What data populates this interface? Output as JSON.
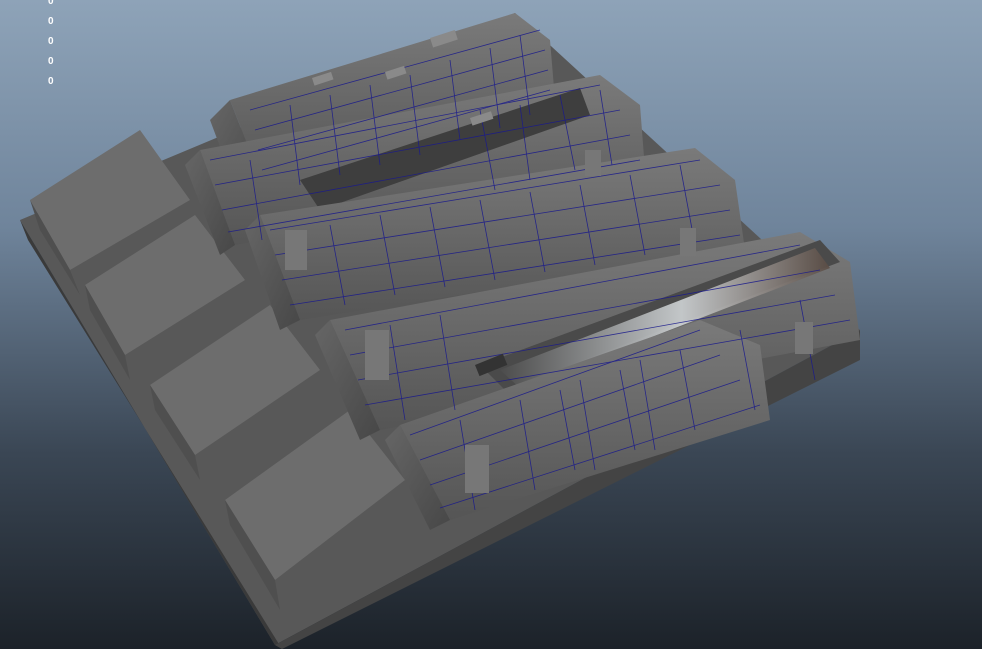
{
  "viewport": {
    "background_top": "#8ea3b8",
    "background_bottom": "#1c2229"
  },
  "hud": {
    "lines": [
      "0",
      "0",
      "0",
      "0",
      "0"
    ]
  },
  "scene": {
    "object": "sci-fi-panel-mesh",
    "wireframe_color": "#1a1a8c",
    "surface_color": "#6a6a6a"
  }
}
